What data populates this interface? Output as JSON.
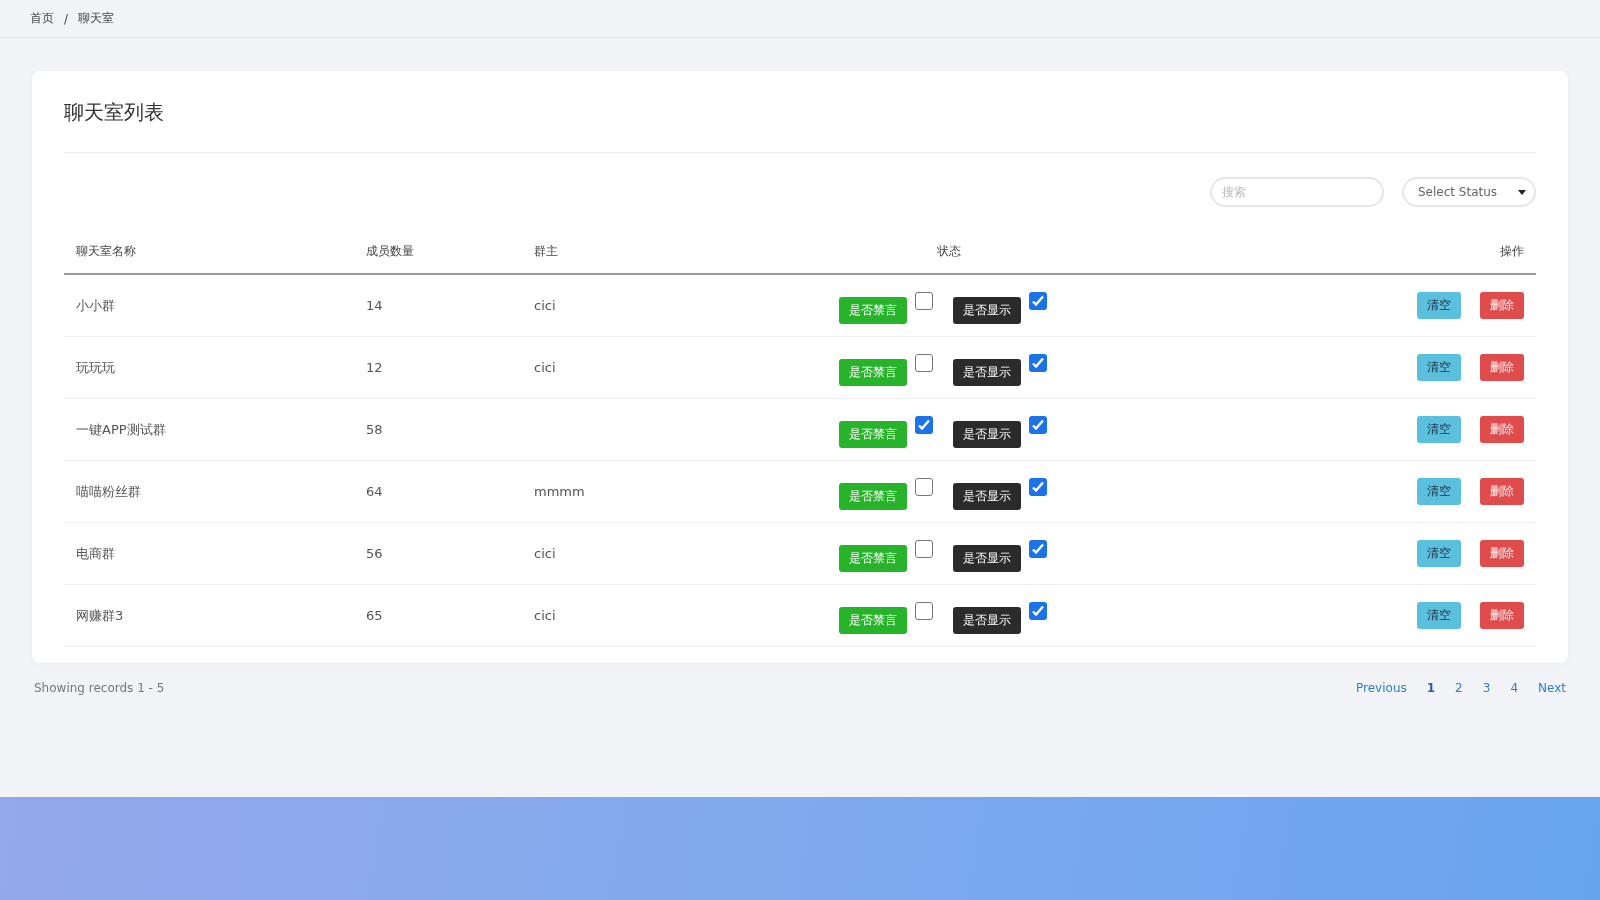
{
  "breadcrumb": {
    "items": [
      "首页",
      "聊天室"
    ],
    "separator": "/"
  },
  "card": {
    "title": "聊天室列表"
  },
  "filters": {
    "search": {
      "placeholder": "搜索"
    },
    "status_select": {
      "value": "Select Status"
    }
  },
  "table": {
    "columns": [
      "聊天室名称",
      "成员数量",
      "群主",
      "状态",
      "操作"
    ],
    "rows": [
      {
        "name": "小小群",
        "members": "14",
        "owner": "cici",
        "mute_label": "是否禁言",
        "muted": false,
        "show_label": "是否显示",
        "shown": true,
        "actions": [
          "清空",
          "删除"
        ]
      },
      {
        "name": "玩玩玩",
        "members": "12",
        "owner": "cici",
        "mute_label": "是否禁言",
        "muted": false,
        "show_label": "是否显示",
        "shown": true,
        "actions": [
          "清空",
          "删除"
        ]
      },
      {
        "name": "一键APP测试群",
        "members": "58",
        "mute_label": "是否禁言",
        "muted": true,
        "show_label": "是否显示",
        "shown": true,
        "actions": [
          "清空",
          "删除"
        ]
      },
      {
        "name": "喵喵粉丝群",
        "members": "64",
        "owner": "mmmm",
        "mute_label": "是否禁言",
        "muted": false,
        "show_label": "是否显示",
        "shown": true,
        "actions": [
          "清空",
          "删除"
        ]
      },
      {
        "name": "电商群",
        "members": "56",
        "owner": "cici",
        "mute_label": "是否禁言",
        "muted": false,
        "show_label": "是否显示",
        "shown": true,
        "actions": [
          "清空",
          "删除"
        ]
      },
      {
        "name": "网赚群3",
        "members": "65",
        "owner": "cici",
        "mute_label": "是否禁言",
        "muted": false,
        "show_label": "是否显示",
        "shown": true,
        "actions": [
          "清空",
          "删除"
        ]
      }
    ]
  },
  "footer": {
    "records": "Showing records 1 - 5",
    "pagination": [
      {
        "label": "Previous",
        "selected": false
      },
      {
        "label": "1",
        "selected": true
      },
      {
        "label": "2",
        "selected": false
      },
      {
        "label": "3",
        "selected": false
      },
      {
        "label": "4",
        "selected": false
      },
      {
        "label": "Next",
        "selected": false
      }
    ]
  }
}
